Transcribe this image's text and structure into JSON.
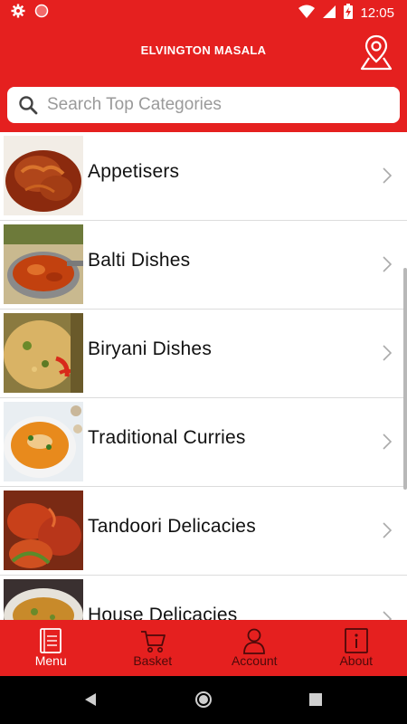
{
  "status_bar": {
    "time": "12:05",
    "icons": [
      "settings-gear-icon",
      "notification-dot-icon",
      "wifi-icon",
      "signal-icon",
      "battery-charging-icon"
    ]
  },
  "app_bar": {
    "title": "ELVINGTON MASALA",
    "location_icon": "map-pin-icon"
  },
  "search": {
    "placeholder": "Search Top Categories",
    "value": ""
  },
  "categories": [
    {
      "label": "Appetisers",
      "image": "onion-bhaji-photo"
    },
    {
      "label": "Balti Dishes",
      "image": "balti-dish-photo"
    },
    {
      "label": "Biryani Dishes",
      "image": "biryani-photo"
    },
    {
      "label": "Traditional Curries",
      "image": "curry-bowl-photo"
    },
    {
      "label": "Tandoori Delicacies",
      "image": "tandoori-chicken-photo"
    },
    {
      "label": "House Delicacies",
      "image": "house-dish-photo"
    }
  ],
  "bottom_nav": {
    "items": [
      {
        "label": "Menu",
        "icon": "menu-book-icon",
        "active": true
      },
      {
        "label": "Basket",
        "icon": "cart-icon",
        "active": false
      },
      {
        "label": "Account",
        "icon": "user-icon",
        "active": false
      },
      {
        "label": "About",
        "icon": "info-icon",
        "active": false
      }
    ]
  },
  "colors": {
    "brand_red": "#e5201f",
    "inactive_nav_text": "#4d0a0a"
  }
}
